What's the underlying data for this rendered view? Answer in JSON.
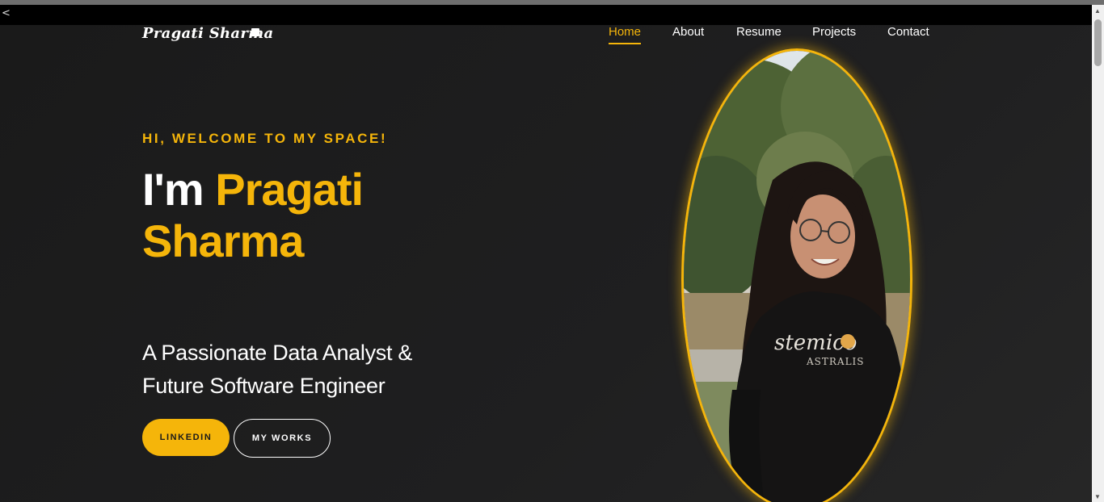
{
  "browser": {
    "back_glyph": "<"
  },
  "header": {
    "logo": "Pragati Sharma",
    "nav": [
      {
        "label": "Home",
        "active": true
      },
      {
        "label": "About",
        "active": false
      },
      {
        "label": "Resume",
        "active": false
      },
      {
        "label": "Projects",
        "active": false
      },
      {
        "label": "Contact",
        "active": false
      }
    ]
  },
  "hero": {
    "greeting": "HI, WELCOME TO MY SPACE!",
    "intro": "I'm",
    "name_first": "Pragati",
    "name_last": "Sharma",
    "subtitle_line1": "A Passionate Data Analyst &",
    "subtitle_line2": "Future Software Engineer",
    "primary_button": "LINKEDIN",
    "secondary_button": "MY WORKS",
    "photo_shirt_text1": "stemico",
    "photo_shirt_text2": "ASTRALIS"
  },
  "colors": {
    "accent": "#f5b50a",
    "background": "#1b1b1c",
    "text": "#ffffff"
  }
}
